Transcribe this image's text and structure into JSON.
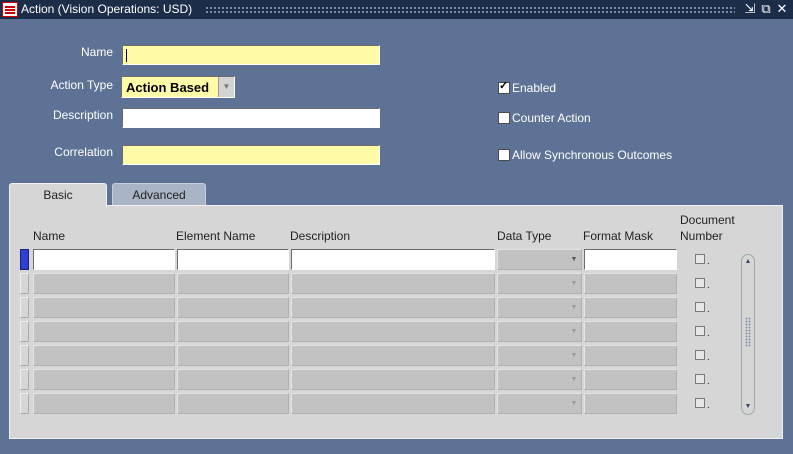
{
  "window": {
    "title": "Action (Vision Operations: USD)",
    "buttons": {
      "minimize": "⇲",
      "maximize": "⧉",
      "close": "✕"
    }
  },
  "form": {
    "name_label": "Name",
    "name_value": "",
    "action_type_label": "Action Type",
    "action_type_value": "Action Based",
    "description_label": "Description",
    "description_value": "",
    "correlation_label": "Correlation",
    "correlation_value": ""
  },
  "checkboxes": {
    "enabled": {
      "label": "Enabled",
      "checked": true
    },
    "counter_action": {
      "label": "Counter Action",
      "checked": false
    },
    "allow_sync": {
      "label": "Allow Synchronous Outcomes",
      "checked": false
    }
  },
  "tabs": [
    {
      "label": "Basic",
      "active": true
    },
    {
      "label": "Advanced",
      "active": false
    }
  ],
  "table": {
    "headers": {
      "name": "Name",
      "element_name": "Element Name",
      "description": "Description",
      "data_type": "Data Type",
      "format_mask": "Format Mask",
      "document_number_1": "Document",
      "document_number_2": "Number"
    },
    "rows": [
      {
        "name": "",
        "element_name": "",
        "description": "",
        "data_type": "",
        "format_mask": "",
        "document_number": false,
        "dot": "."
      },
      {
        "name": "",
        "element_name": "",
        "description": "",
        "data_type": "",
        "format_mask": "",
        "document_number": false,
        "dot": "."
      },
      {
        "name": "",
        "element_name": "",
        "description": "",
        "data_type": "",
        "format_mask": "",
        "document_number": false,
        "dot": "."
      },
      {
        "name": "",
        "element_name": "",
        "description": "",
        "data_type": "",
        "format_mask": "",
        "document_number": false,
        "dot": "."
      },
      {
        "name": "",
        "element_name": "",
        "description": "",
        "data_type": "",
        "format_mask": "",
        "document_number": false,
        "dot": "."
      },
      {
        "name": "",
        "element_name": "",
        "description": "",
        "data_type": "",
        "format_mask": "",
        "document_number": false,
        "dot": "."
      },
      {
        "name": "",
        "element_name": "",
        "description": "",
        "data_type": "",
        "format_mask": "",
        "document_number": false,
        "dot": "."
      }
    ]
  },
  "colors": {
    "background": "#5d7294",
    "titlebar": "#1c2d4a",
    "required_field": "#fffaa7",
    "panel": "#d6d6d6",
    "selected_row_marker": "#2f3fd2"
  },
  "icons": [
    "oracle-logo-icon",
    "minimize-icon",
    "maximize-icon",
    "close-icon",
    "chevron-down-icon",
    "scroll-up-icon",
    "scroll-down-icon"
  ]
}
